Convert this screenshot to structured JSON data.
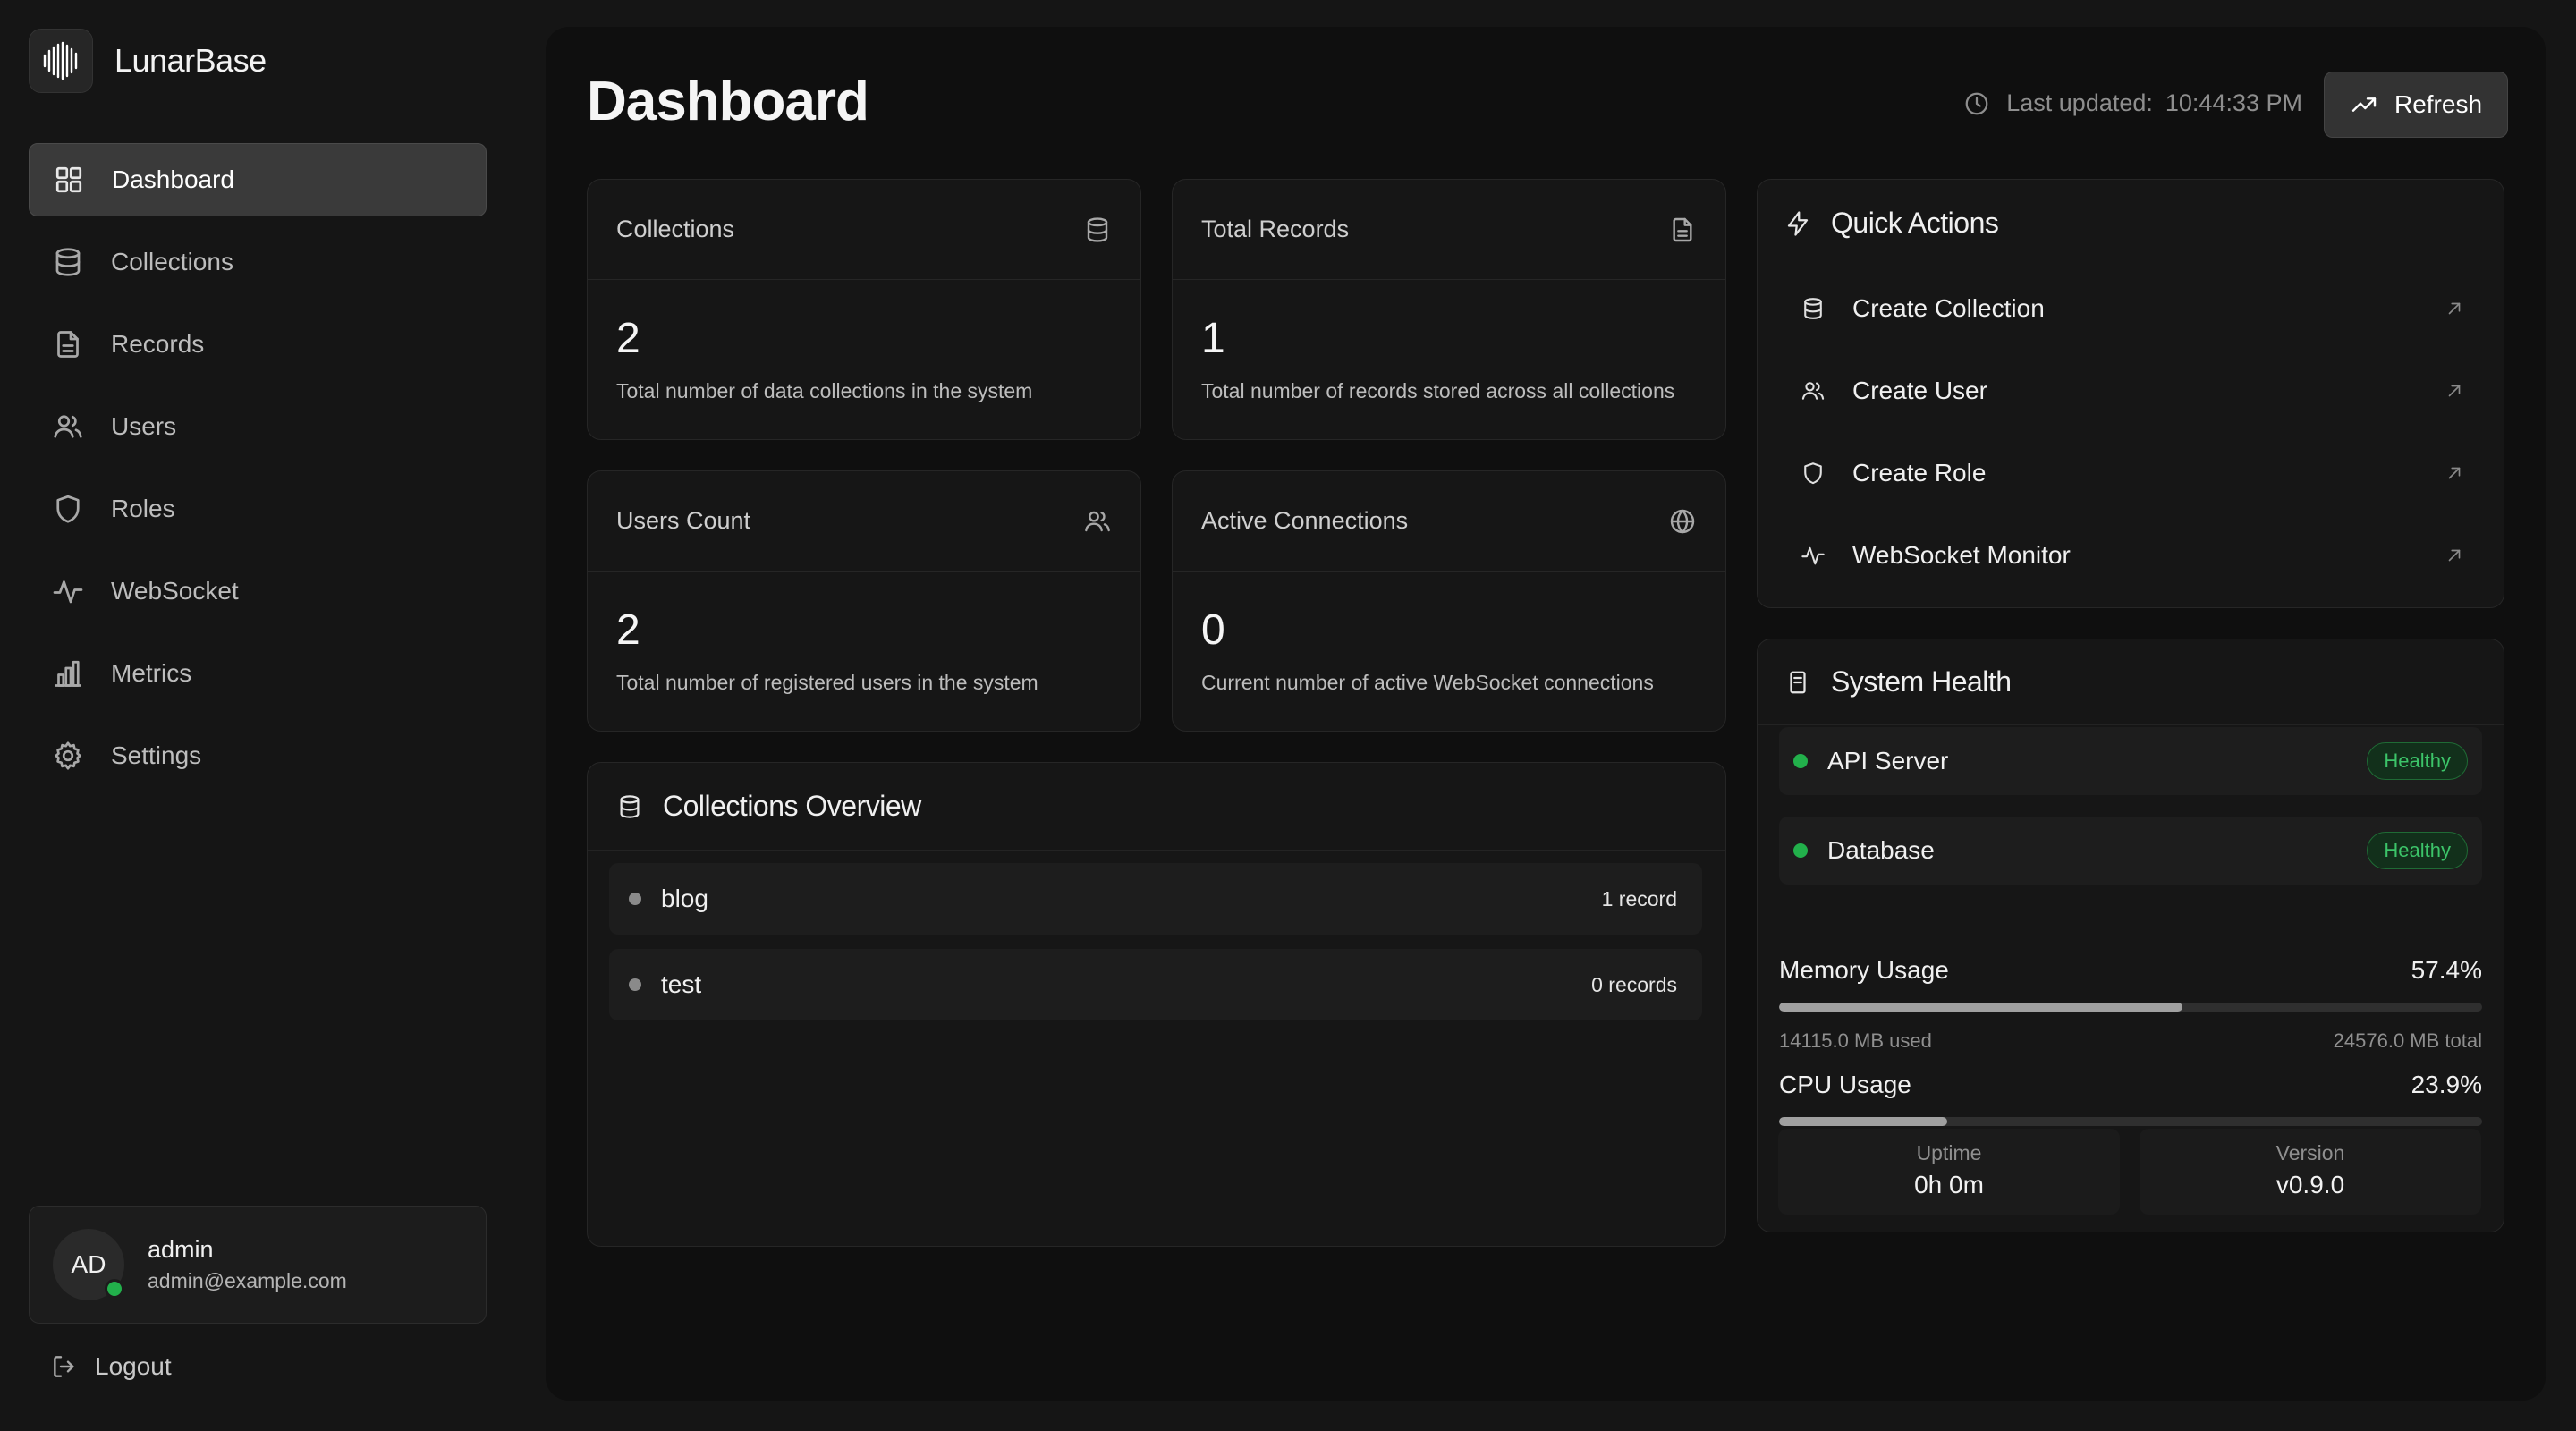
{
  "brand": {
    "name": "LunarBase"
  },
  "nav": {
    "items": [
      {
        "label": "Dashboard",
        "icon": "grid-icon",
        "active": true
      },
      {
        "label": "Collections",
        "icon": "database-icon",
        "active": false
      },
      {
        "label": "Records",
        "icon": "document-icon",
        "active": false
      },
      {
        "label": "Users",
        "icon": "users-icon",
        "active": false
      },
      {
        "label": "Roles",
        "icon": "shield-icon",
        "active": false
      },
      {
        "label": "WebSocket",
        "icon": "activity-icon",
        "active": false
      },
      {
        "label": "Metrics",
        "icon": "bar-chart-icon",
        "active": false
      },
      {
        "label": "Settings",
        "icon": "gear-icon",
        "active": false
      }
    ]
  },
  "user": {
    "initials": "AD",
    "name": "admin",
    "email": "admin@example.com",
    "online": true
  },
  "logout": {
    "label": "Logout"
  },
  "header": {
    "title": "Dashboard",
    "last_updated_label": "Last updated:",
    "last_updated_time": "10:44:33 PM",
    "refresh_label": "Refresh"
  },
  "stats": [
    {
      "title": "Collections",
      "value": "2",
      "description": "Total number of data collections in the system",
      "icon": "database-icon"
    },
    {
      "title": "Total Records",
      "value": "1",
      "description": "Total number of records stored across all collections",
      "icon": "document-icon"
    },
    {
      "title": "Users Count",
      "value": "2",
      "description": "Total number of registered users in the system",
      "icon": "users-icon"
    },
    {
      "title": "Active Connections",
      "value": "0",
      "description": "Current number of active WebSocket connections",
      "icon": "globe-icon"
    }
  ],
  "collections_overview": {
    "title": "Collections Overview",
    "items": [
      {
        "name": "blog",
        "count": "1 record"
      },
      {
        "name": "test",
        "count": "0 records"
      }
    ]
  },
  "quick_actions": {
    "title": "Quick Actions",
    "items": [
      {
        "label": "Create Collection",
        "icon": "database-icon"
      },
      {
        "label": "Create User",
        "icon": "users-icon"
      },
      {
        "label": "Create Role",
        "icon": "shield-icon"
      },
      {
        "label": "WebSocket Monitor",
        "icon": "activity-icon"
      }
    ]
  },
  "system_health": {
    "title": "System Health",
    "services": [
      {
        "name": "API Server",
        "status": "Healthy"
      },
      {
        "name": "Database",
        "status": "Healthy"
      }
    ],
    "memory": {
      "label": "Memory Usage",
      "percent": "57.4%",
      "fraction": 0.574,
      "used": "14115.0 MB used",
      "total": "24576.0 MB total"
    },
    "cpu": {
      "label": "CPU Usage",
      "percent": "23.9%",
      "fraction": 0.239
    },
    "uptime": {
      "label": "Uptime",
      "value": "0h 0m"
    },
    "version": {
      "label": "Version",
      "value": "v0.9.0"
    }
  },
  "colors": {
    "background": "#151515",
    "panel": "#0f0f0f",
    "card": "#161616",
    "accent_active": "#3a3a3a",
    "healthy": "#22b04b"
  }
}
